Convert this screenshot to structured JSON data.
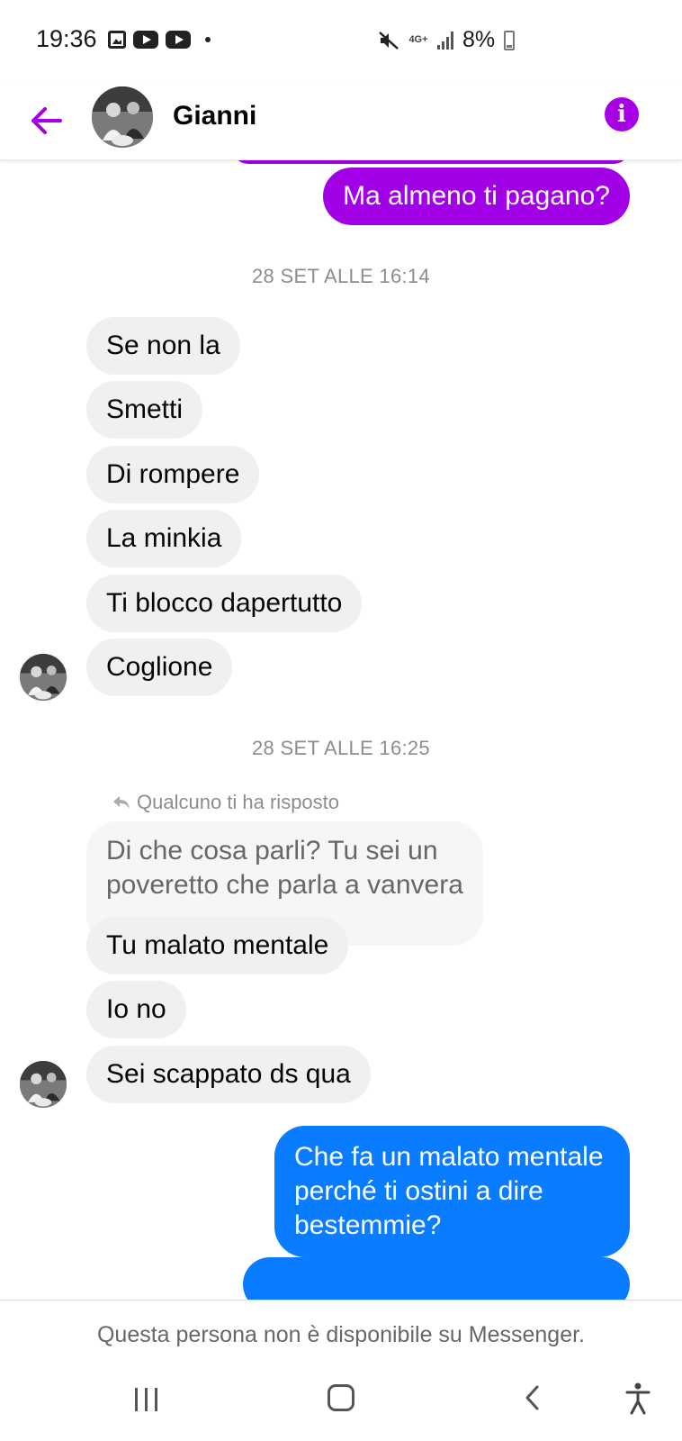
{
  "status_bar": {
    "time": "19:36",
    "battery": "8%",
    "network": "4G+",
    "icons": [
      "gallery-icon",
      "youtube-icon",
      "youtube-icon",
      "dot-icon",
      "mute-icon",
      "signal-icon",
      "battery-charging-icon"
    ]
  },
  "header": {
    "contact_name": "Gianni",
    "back_icon": "arrow-left-icon",
    "info_icon": "info-icon",
    "info_symbol": "i",
    "accent_color": "#a800e6"
  },
  "conversation": {
    "outgoing_top": "Ma almeno ti pagano?",
    "timestamp_1": "28 SET ALLE 16:14",
    "group_1": [
      "Se non la",
      "Smetti",
      "Di rompere",
      "La minkia",
      "Ti blocco dapertutto",
      "Coglione"
    ],
    "timestamp_2": "28 SET ALLE 16:25",
    "reply_label": "Qualcuno ti ha risposto",
    "quoted_lines": [
      "Di che cosa parli? Tu sei un",
      "poveretto che parla a vanvera"
    ],
    "group_2": [
      "Tu malato mentale",
      "Io no",
      "Sei scappato ds qua"
    ],
    "outgoing_blue_lines": [
      "Che fa un malato mentale",
      "perché ti ostini a dire",
      "bestemmie?"
    ]
  },
  "footer": {
    "unavailable_text": "Questa persona non è disponibile su Messenger."
  },
  "colors": {
    "outgoing_purple": "#a200e6",
    "outgoing_blue": "#0a7cff",
    "incoming_gray": "#f0f0f0"
  }
}
